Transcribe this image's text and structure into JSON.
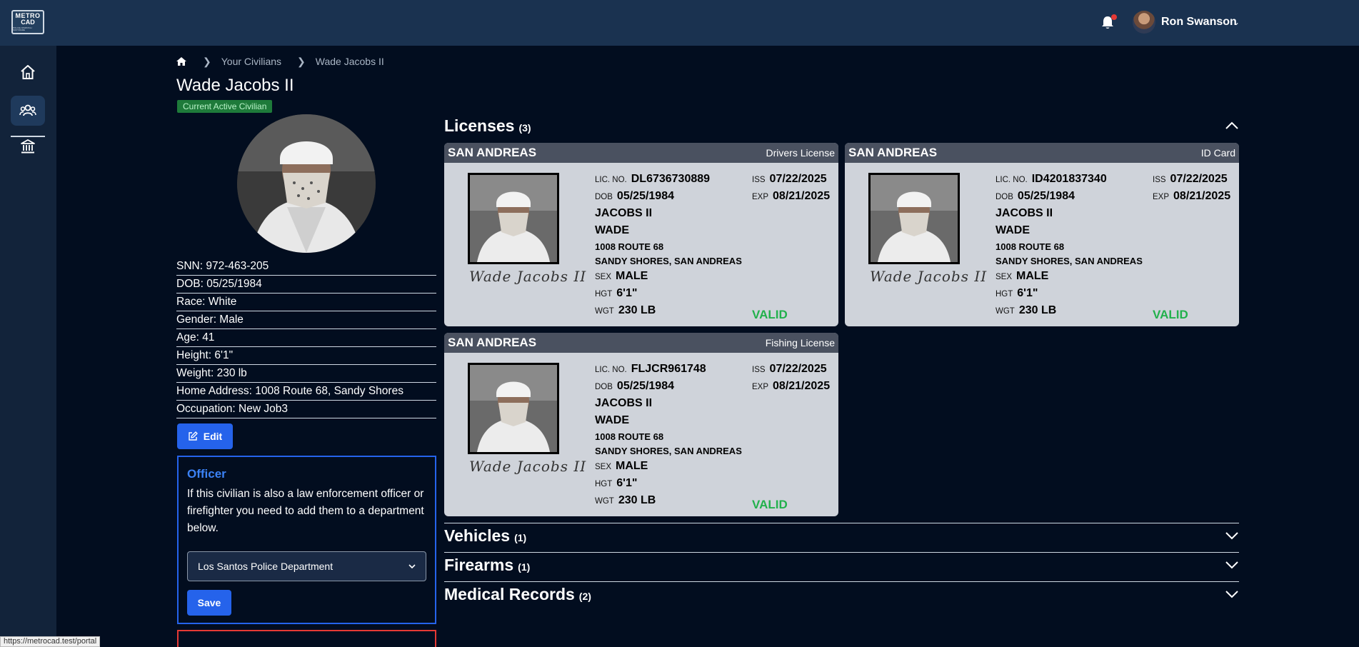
{
  "header": {
    "logo_line1": "METRO",
    "logo_line2": "CAD",
    "logo_line3": "POLICE DISPATCH SOFTWARE",
    "user_name": "Ron Swanson"
  },
  "breadcrumb": [
    "Your Civilians",
    "Wade Jacobs II"
  ],
  "civilian": {
    "name": "Wade Jacobs II",
    "badge": "Current Active Civilian",
    "info": [
      "SNN: 972-463-205",
      "DOB: 05/25/1984",
      "Race: White",
      "Gender: Male",
      "Age: 41",
      "Height: 6'1\"",
      "Weight: 230 lb",
      "Home Address: 1008 Route 68, Sandy Shores",
      "Occupation: New Job3"
    ],
    "edit_label": "Edit"
  },
  "officer": {
    "title": "Officer",
    "text": "If this civilian is also a law enforcement officer or firefighter you need to add them to a department below.",
    "selected_department": "Los Santos Police Department",
    "save_label": "Save"
  },
  "sections": {
    "licenses": {
      "title": "Licenses",
      "count": "(3)"
    },
    "vehicles": {
      "title": "Vehicles",
      "count": "(1)"
    },
    "firearms": {
      "title": "Firearms",
      "count": "(1)"
    },
    "medical": {
      "title": "Medical Records",
      "count": "(2)"
    }
  },
  "license_labels": {
    "lic_no": "LIC. NO.",
    "dob": "DOB",
    "iss": "ISS",
    "exp": "EXP",
    "sex": "SEX",
    "hgt": "HGT",
    "wgt": "WGT"
  },
  "licenses": [
    {
      "state": "SAN ANDREAS",
      "type": "Drivers License",
      "lic_no": "DL6736730889",
      "dob": "05/25/1984",
      "last": "JACOBS II",
      "first": "WADE",
      "address1": "1008 ROUTE 68",
      "address2": "SANDY SHORES, SAN ANDREAS",
      "sex": "MALE",
      "hgt": "6'1\"",
      "wgt": "230 LB",
      "iss": "07/22/2025",
      "exp": "08/21/2025",
      "status": "VALID",
      "signature": "Wade Jacobs II"
    },
    {
      "state": "SAN ANDREAS",
      "type": "ID Card",
      "lic_no": "ID4201837340",
      "dob": "05/25/1984",
      "last": "JACOBS II",
      "first": "WADE",
      "address1": "1008 ROUTE 68",
      "address2": "SANDY SHORES, SAN ANDREAS",
      "sex": "MALE",
      "hgt": "6'1\"",
      "wgt": "230 LB",
      "iss": "07/22/2025",
      "exp": "08/21/2025",
      "status": "VALID",
      "signature": "Wade Jacobs II"
    },
    {
      "state": "SAN ANDREAS",
      "type": "Fishing License",
      "lic_no": "FLJCR961748",
      "dob": "05/25/1984",
      "last": "JACOBS II",
      "first": "WADE",
      "address1": "1008 ROUTE 68",
      "address2": "SANDY SHORES, SAN ANDREAS",
      "sex": "MALE",
      "hgt": "6'1\"",
      "wgt": "230 LB",
      "iss": "07/22/2025",
      "exp": "08/21/2025",
      "status": "VALID",
      "signature": "Wade Jacobs II"
    }
  ],
  "status_bar_url": "https://metrocad.test/portal"
}
